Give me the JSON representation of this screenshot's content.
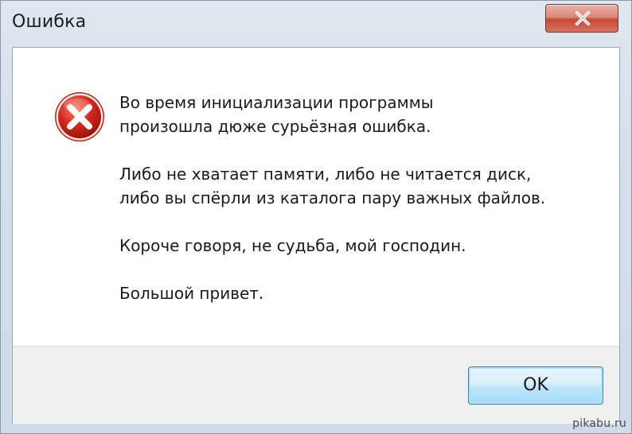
{
  "window": {
    "title": "Ошибка",
    "close_icon": "close-icon"
  },
  "icon": {
    "name": "error-icon",
    "color": "#d42a1d"
  },
  "message": {
    "paragraphs": [
      [
        "Во время инициализации программы",
        "произошла дюже сурьёзная ошибка."
      ],
      [
        "Либо не хватает памяти, либо не читается диск,",
        "либо вы спёрли из каталога пару важных файлов."
      ],
      [
        "Короче говоря, не судьба, мой господин."
      ],
      [
        "Большой привет."
      ]
    ]
  },
  "buttons": {
    "ok_label": "OK"
  },
  "watermark": {
    "text": "pikabu.ru"
  }
}
